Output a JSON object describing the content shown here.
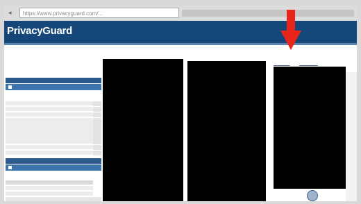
{
  "browser": {
    "url": "https://www.privacyguard.com/..."
  },
  "site": {
    "brand": "PrivacyGuard"
  },
  "colors": {
    "header": "#16477a",
    "section_header": "#2c5a8c",
    "annotation_arrow": "#e8251b",
    "redaction": "#000000"
  },
  "icons": {
    "back": "back-arrow-icon",
    "arrow": "red-down-arrow-icon",
    "logo": "globe-icon"
  }
}
